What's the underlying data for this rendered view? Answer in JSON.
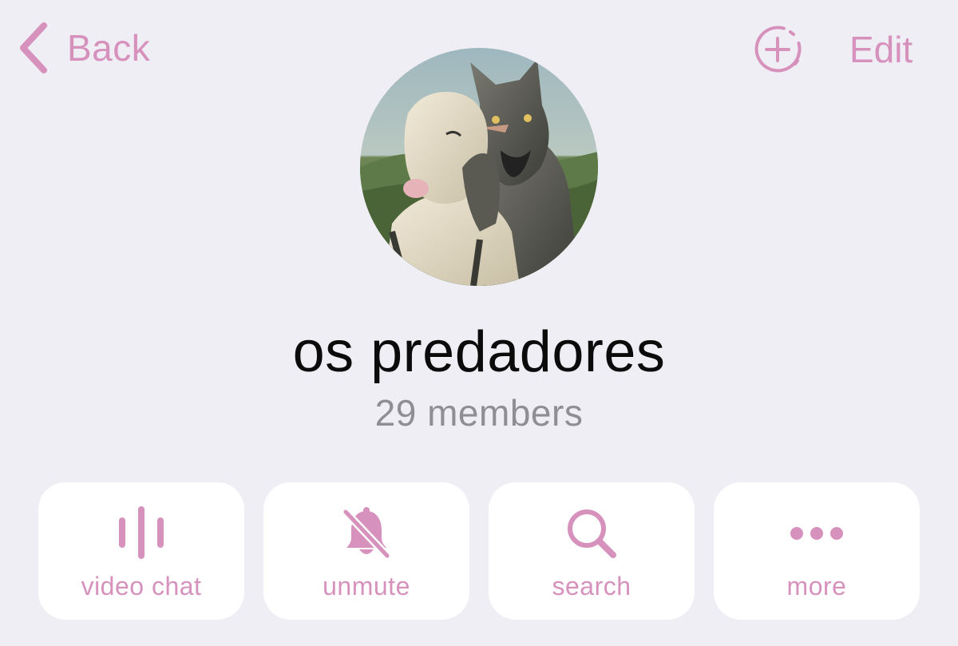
{
  "nav": {
    "back_label": "Back",
    "edit_label": "Edit",
    "add_member_icon": "add-member-circle-icon"
  },
  "group": {
    "name": "os predadores",
    "member_count": "29 members",
    "avatar_icon": "group-avatar-image"
  },
  "actions": [
    {
      "label": "video chat",
      "icon": "voice-wave-icon"
    },
    {
      "label": "unmute",
      "icon": "bell-slash-icon"
    },
    {
      "label": "search",
      "icon": "magnifier-icon"
    },
    {
      "label": "more",
      "icon": "ellipsis-icon"
    }
  ],
  "colors": {
    "accent": "#d691bc",
    "background": "#efeef4",
    "card": "#ffffff",
    "title": "#0b0b0c",
    "subtitle": "#8e8e93"
  }
}
